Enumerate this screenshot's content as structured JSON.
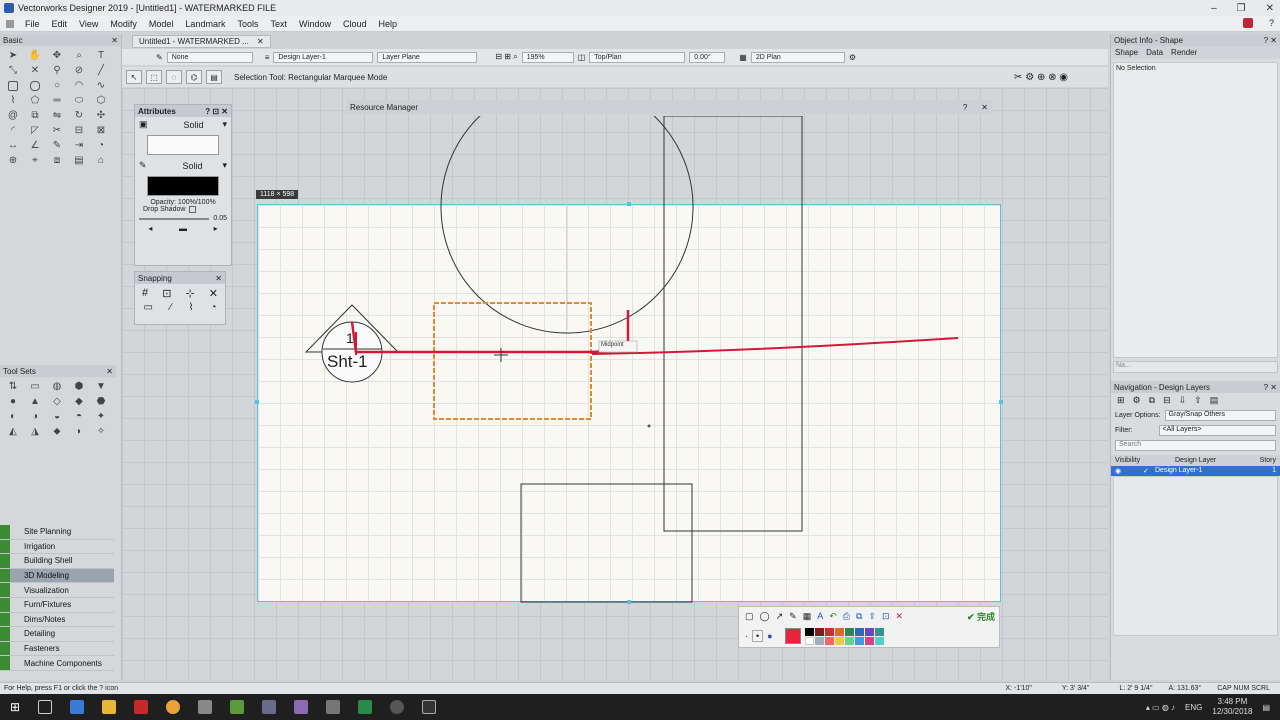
{
  "window": {
    "title": "Vectorworks Designer 2019 - [Untitled1] - WATERMARKED FILE",
    "controls": [
      "–",
      "❐",
      "✕"
    ]
  },
  "menubar": {
    "items": [
      "File",
      "Edit",
      "View",
      "Modify",
      "Model",
      "Landmark",
      "Tools",
      "Text",
      "Window",
      "Cloud",
      "Help"
    ]
  },
  "doc_tab": {
    "label": "Untitled1 - WATERMARKED ...",
    "close": "✕"
  },
  "viewbar": {
    "class_value": "None",
    "layer_value": "Design Layer-1",
    "plane_value": "Layer Plane",
    "zoom_value": "195%",
    "view_value": "Top/Plan",
    "rotation_value": "0.00°",
    "render_value": "2D Plan"
  },
  "modebar": {
    "mode_label": "Selection Tool: Rectangular Marquee Mode"
  },
  "left_palette": {
    "basic_title": "Basic",
    "toolsets_title": "Tool Sets",
    "close": "✕",
    "sets": [
      "Site Planning",
      "Irrigation",
      "Building Shell",
      "3D Modeling",
      "Visualization",
      "Furn/Fixtures",
      "Dims/Notes",
      "Detailing",
      "Fasteners",
      "Machine Components"
    ],
    "active_set": "3D Modeling"
  },
  "attributes": {
    "title": "Attributes",
    "help": "?",
    "pin": "⊡",
    "close": "✕",
    "fill_style": "Solid",
    "pen_style": "Solid",
    "opacity_label": "Opacity: 100%/100%",
    "drop_shadow_label": "Drop Shadow",
    "thickness": "0.05"
  },
  "snapping": {
    "title": "Snapping",
    "close": "✕"
  },
  "resource_manager": {
    "title": "Resource Manager",
    "help": "?",
    "close": "✕"
  },
  "canvas": {
    "dimension_badge": "1118 × 598",
    "marker_number": "1",
    "marker_sheet": "Sht-1",
    "snap_label": "Midpoint"
  },
  "annotation_toolbar": {
    "done_label": "完成"
  },
  "object_info": {
    "title": "Object Info - Shape",
    "tabs": [
      "Shape",
      "Data",
      "Render"
    ],
    "selection_text": "No Selection",
    "name_placeholder": "Na..."
  },
  "navigation": {
    "title": "Navigation - Design Layers",
    "layer_options_label": "Layer Options:",
    "layer_options_value": "Gray/Snap Others",
    "filter_label": "Filter:",
    "filter_value": "<All Layers>",
    "search_placeholder": "Search",
    "col_visibility": "Visibility",
    "col_design_layer": "Design Layer",
    "col_story": "Story",
    "layer_row_name": "Design Layer-1",
    "layer_row_story": "1"
  },
  "status": {
    "help_text": "For Help, press F1 or click the ? icon",
    "x_coord": "X: -1'10\"",
    "y_coord": "Y: 3' 3/4\"",
    "length": "L: 2' 9 1/4\"",
    "angle": "A: 131.63°",
    "indicators": "CAP  NUM  SCRL"
  },
  "taskbar": {
    "lang": "ENG",
    "time": "3:48 PM",
    "date": "12/30/2018"
  },
  "colors": {
    "accent_red": "#d5183a",
    "selection_orange": "#e08a33",
    "canvas_border": "#5cc2dc",
    "active_layer_blue": "#2f6fd6"
  }
}
